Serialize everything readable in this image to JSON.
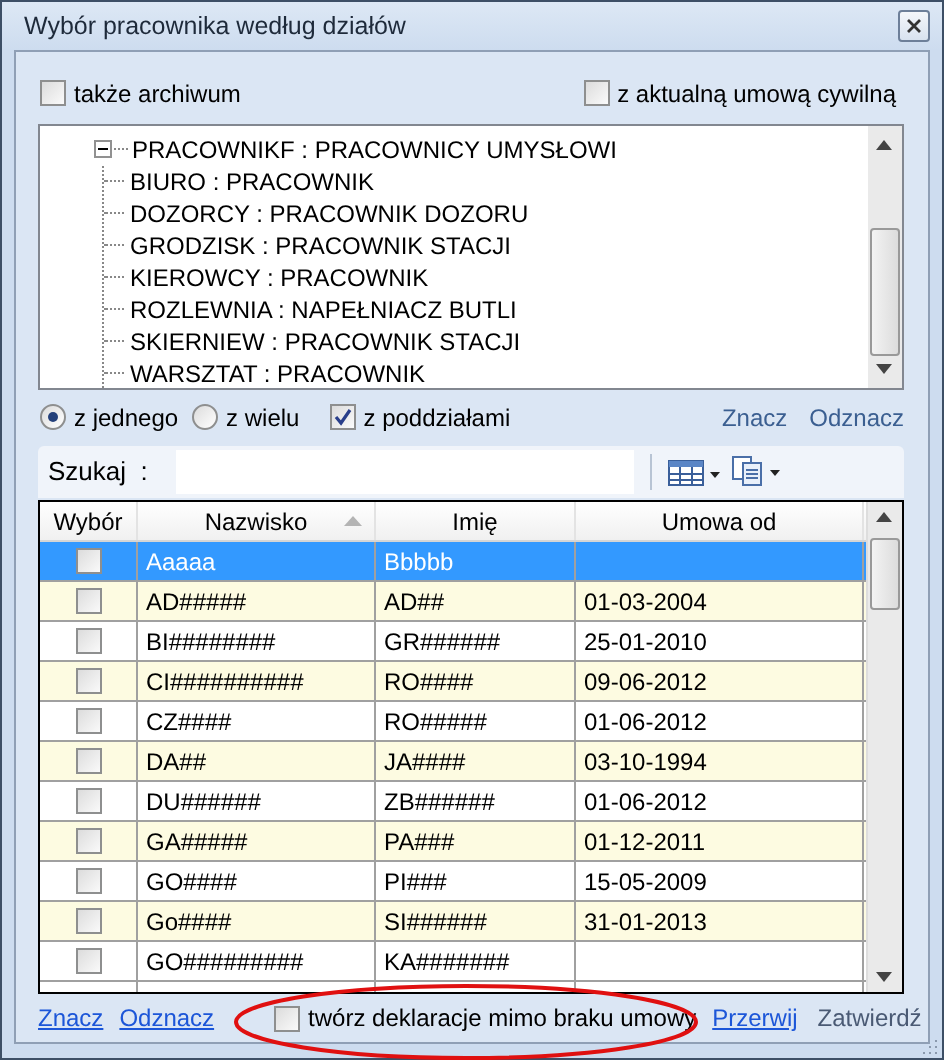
{
  "window": {
    "title": "Wybór pracownika według działów"
  },
  "options": [
    {
      "label": "także archiwum",
      "checked": false
    },
    {
      "label": "z aktualną umową cywilną",
      "checked": false
    }
  ],
  "tree": [
    {
      "label": "PRACOWNIKF : PRACOWNICY UMYSŁOWI",
      "expanded": true,
      "children": [
        {
          "label": "BIURO : PRACOWNIK"
        },
        {
          "label": "DOZORCY : PRACOWNIK DOZORU"
        },
        {
          "label": "GRODZISK : PRACOWNIK STACJI"
        },
        {
          "label": "KIEROWCY : PRACOWNIK"
        },
        {
          "label": "ROZLEWNIA : NAPEŁNIACZ BUTLI"
        },
        {
          "label": "SKIERNIEW : PRACOWNIK STACJI"
        },
        {
          "label": "WARSZTAT : PRACOWNIK"
        }
      ]
    }
  ],
  "filters": [
    {
      "kind": "radio",
      "label": "z jednego",
      "selected": true
    },
    {
      "kind": "radio",
      "label": "z wielu",
      "selected": false
    },
    {
      "kind": "checkbox",
      "label": "z poddziałami",
      "checked": true
    }
  ],
  "top_links": [
    "Znacz",
    "Odznacz"
  ],
  "search": {
    "label": "Szukaj  :"
  },
  "table": {
    "columns": [
      {
        "label": "Wybór",
        "sorted": false
      },
      {
        "label": "Nazwisko",
        "sorted": true
      },
      {
        "label": "Imię",
        "sorted": false
      },
      {
        "label": "Umowa od",
        "sorted": false
      }
    ],
    "rows": [
      {
        "checked": false,
        "selected": true,
        "cells": [
          "Aaaaa",
          "Bbbbb",
          ""
        ]
      },
      {
        "checked": false,
        "selected": false,
        "cells": [
          "AD#####",
          "AD##",
          "01-03-2004"
        ]
      },
      {
        "checked": false,
        "selected": false,
        "cells": [
          "BI########",
          "GR######",
          "25-01-2010"
        ]
      },
      {
        "checked": false,
        "selected": false,
        "cells": [
          "CI##########",
          "RO####",
          "09-06-2012"
        ]
      },
      {
        "checked": false,
        "selected": false,
        "cells": [
          "CZ####",
          "RO#####",
          "01-06-2012"
        ]
      },
      {
        "checked": false,
        "selected": false,
        "cells": [
          "DA##",
          "JA####",
          "03-10-1994"
        ]
      },
      {
        "checked": false,
        "selected": false,
        "cells": [
          "DU######",
          "ZB######",
          "01-06-2012"
        ]
      },
      {
        "checked": false,
        "selected": false,
        "cells": [
          "GA#####",
          "PA###",
          "01-12-2011"
        ]
      },
      {
        "checked": false,
        "selected": false,
        "cells": [
          "GO####",
          "PI###",
          "15-05-2009"
        ]
      },
      {
        "checked": false,
        "selected": false,
        "cells": [
          "Go####",
          "SI######",
          "31-01-2013"
        ]
      },
      {
        "checked": false,
        "selected": false,
        "cells": [
          "GO#########",
          "KA#######",
          ""
        ]
      }
    ]
  },
  "footer": {
    "links": [
      "Znacz",
      "Odznacz"
    ],
    "option": {
      "label": "twórz deklaracje mimo braku umowy",
      "checked": false
    },
    "actions": [
      {
        "kind": "link",
        "label": "Przerwij"
      },
      {
        "kind": "plain",
        "label": "Zatwierdź"
      }
    ]
  },
  "annotation": {
    "visible": true
  }
}
